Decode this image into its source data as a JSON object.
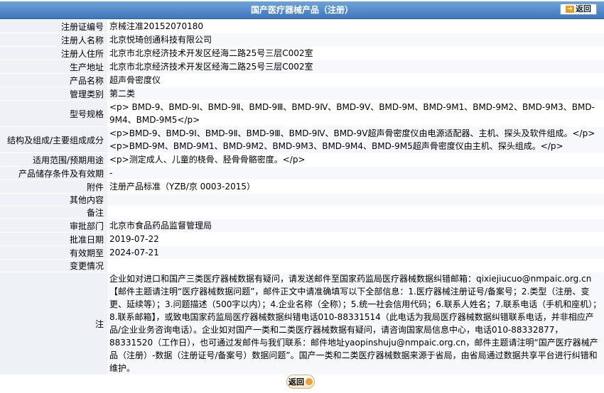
{
  "header": {
    "title": "国产医疗器械产品（注册）",
    "back_label": "返回"
  },
  "rows": [
    {
      "label": "注册证编号",
      "value": "京械注准20152070180"
    },
    {
      "label": "注册人名称",
      "value": "北京悦琦创通科技有限公司"
    },
    {
      "label": "注册人住所",
      "value": "北京市北京经济技术开发区经海二路25号三层C002室"
    },
    {
      "label": "生产地址",
      "value": "北京市北京经济技术开发区经海二路25号三层C002室"
    },
    {
      "label": "产品名称",
      "value": "超声骨密度仪"
    },
    {
      "label": "管理类别",
      "value": "第二类"
    },
    {
      "label": "型号规格",
      "value": "<p> BMD-9、BMD-9Ⅰ、BMD-9Ⅱ、BMD-9Ⅲ、BMD-9Ⅳ、BMD-9Ⅴ、BMD-9M、BMD-9M1、BMD-9M2、BMD-9M3、BMD-9M4、BMD-9M5</p>"
    },
    {
      "label": "结构及组成/主要组成成分",
      "value": "<p>BMD-9、BMD-9Ⅰ、BMD-9Ⅱ、BMD-9Ⅲ、BMD-9Ⅳ、BMD-9Ⅴ超声骨密度仪由电源适配器、主机、探头及软件组成。</p><p>BMD-9M、BMD-9M1、BMD-9M2、BMD-9M3、BMD-9M4、BMD-9M5超声骨密度仪由主机、探头组成。</p>"
    },
    {
      "label": "适用范围/预期用途",
      "value": "<p>测定成人、儿童的桡骨、胫骨骨骼密度。</p>"
    },
    {
      "label": "产品储存条件及有效期",
      "value": "-"
    },
    {
      "label": "附件",
      "value": "注册产品标准（YZB/京 0003-2015）"
    },
    {
      "label": "其他内容",
      "value": ""
    },
    {
      "label": "备注",
      "value": ""
    },
    {
      "label": "审批部门",
      "value": "北京市食品药品监督管理局"
    },
    {
      "label": "批准日期",
      "value": "2019-07-22"
    },
    {
      "label": "有效期至",
      "value": "2024-07-21"
    },
    {
      "label": "变更情况",
      "value": ""
    }
  ],
  "note": {
    "label": "注",
    "text": "企业如对进口和国产三类医疗器械数据有疑问，请发送邮件至国家药监局医疗器械数据纠错邮箱：qixiejiucuo@nmpaic.org.cn【邮件主题请注明“医疗器械数据问题”，邮件正文中请准确填写以下全部信息：1.医疗器械注册证号/备案号；2.类型（注册、变更、延续等）；3.问题描述（500字以内）；4.企业名称（全称）；5.统一社会信用代码；6.联系人姓名；7.联系电话（手机和座机）；8.联系邮箱】，或致电国家药监局医疗器械数据纠错电话010-88331514（此电话为我局医疗器械数据纠错联系电话，并非相应产品/企业业务咨询电话）。企业如对国产一类和二类医疗器械数据有疑问，请咨询国家局信息中心，电话010-88332877，88331520（工作日），也可通过发邮件与我们联系：邮件地址yaopinshuju@nmpaic.org.cn，邮件主题请注明“国产医疗器械产品（注册）-数据（注册证号/备案号）数据问题”。国产一类和二类医疗器械数据来源于省局，由省局通过数据共享平台进行纠错和维护。"
  },
  "footer": {
    "back_label": "返回"
  }
}
